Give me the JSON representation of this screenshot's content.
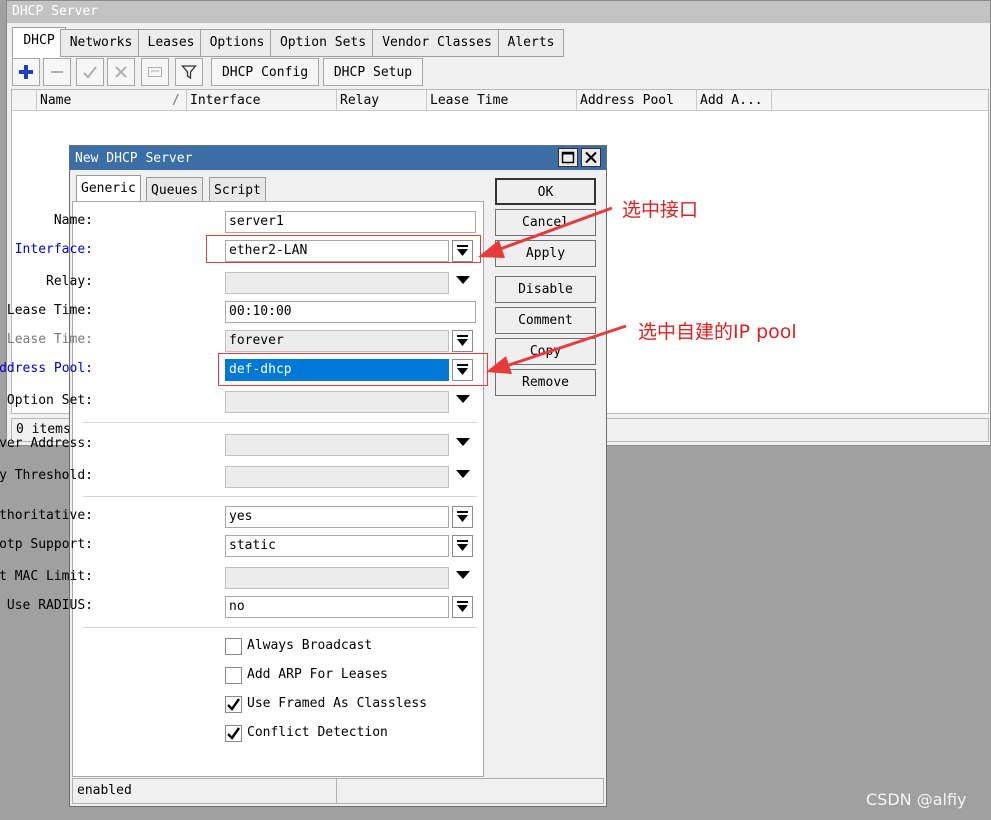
{
  "main_window": {
    "title": "DHCP Server",
    "tabs": [
      "DHCP",
      "Networks",
      "Leases",
      "Options",
      "Option Sets",
      "Vendor Classes",
      "Alerts"
    ],
    "toolbar": {
      "dhcp_config": "DHCP Config",
      "dhcp_setup": "DHCP Setup"
    },
    "columns": [
      "Name",
      "/",
      "Interface",
      "Relay",
      "Lease Time",
      "Address Pool",
      "Add A..."
    ],
    "status": "0 items"
  },
  "dialog": {
    "title": "New DHCP Server",
    "tabs": [
      "Generic",
      "Queues",
      "Script"
    ],
    "fields": {
      "name": {
        "label": "Name:",
        "value": "server1"
      },
      "interface": {
        "label": "Interface:",
        "value": "ether2-LAN"
      },
      "relay": {
        "label": "Relay:",
        "value": ""
      },
      "lease_time": {
        "label": "Lease Time:",
        "value": "00:10:00"
      },
      "bootp_lease_time": {
        "label": "Bootp Lease Time:",
        "value": "forever"
      },
      "address_pool": {
        "label": "Address Pool:",
        "value": "def-dhcp"
      },
      "dhcp_option_set": {
        "label": "DHCP Option Set:",
        "value": ""
      },
      "server_address": {
        "label": "Server Address:",
        "value": ""
      },
      "delay_threshold": {
        "label": "Delay Threshold:",
        "value": ""
      },
      "authoritative": {
        "label": "Authoritative:",
        "value": "yes"
      },
      "bootp_support": {
        "label": "Bootp Support:",
        "value": "static"
      },
      "client_mac_limit": {
        "label": "Client MAC Limit:",
        "value": ""
      },
      "use_radius": {
        "label": "Use RADIUS:",
        "value": "no"
      }
    },
    "checkboxes": [
      {
        "label": "Always Broadcast",
        "checked": false
      },
      {
        "label": "Add ARP For Leases",
        "checked": false
      },
      {
        "label": "Use Framed As Classless",
        "checked": true
      },
      {
        "label": "Conflict Detection",
        "checked": true
      }
    ],
    "buttons": {
      "ok": "OK",
      "cancel": "Cancel",
      "apply": "Apply",
      "disable": "Disable",
      "comment": "Comment",
      "copy": "Copy",
      "remove": "Remove"
    },
    "status": "enabled"
  },
  "annotations": {
    "interface_note": "选中接口",
    "pool_note": "选中自建的IP pool",
    "color": "#e83a3a"
  },
  "watermark": "CSDN @alfiy"
}
